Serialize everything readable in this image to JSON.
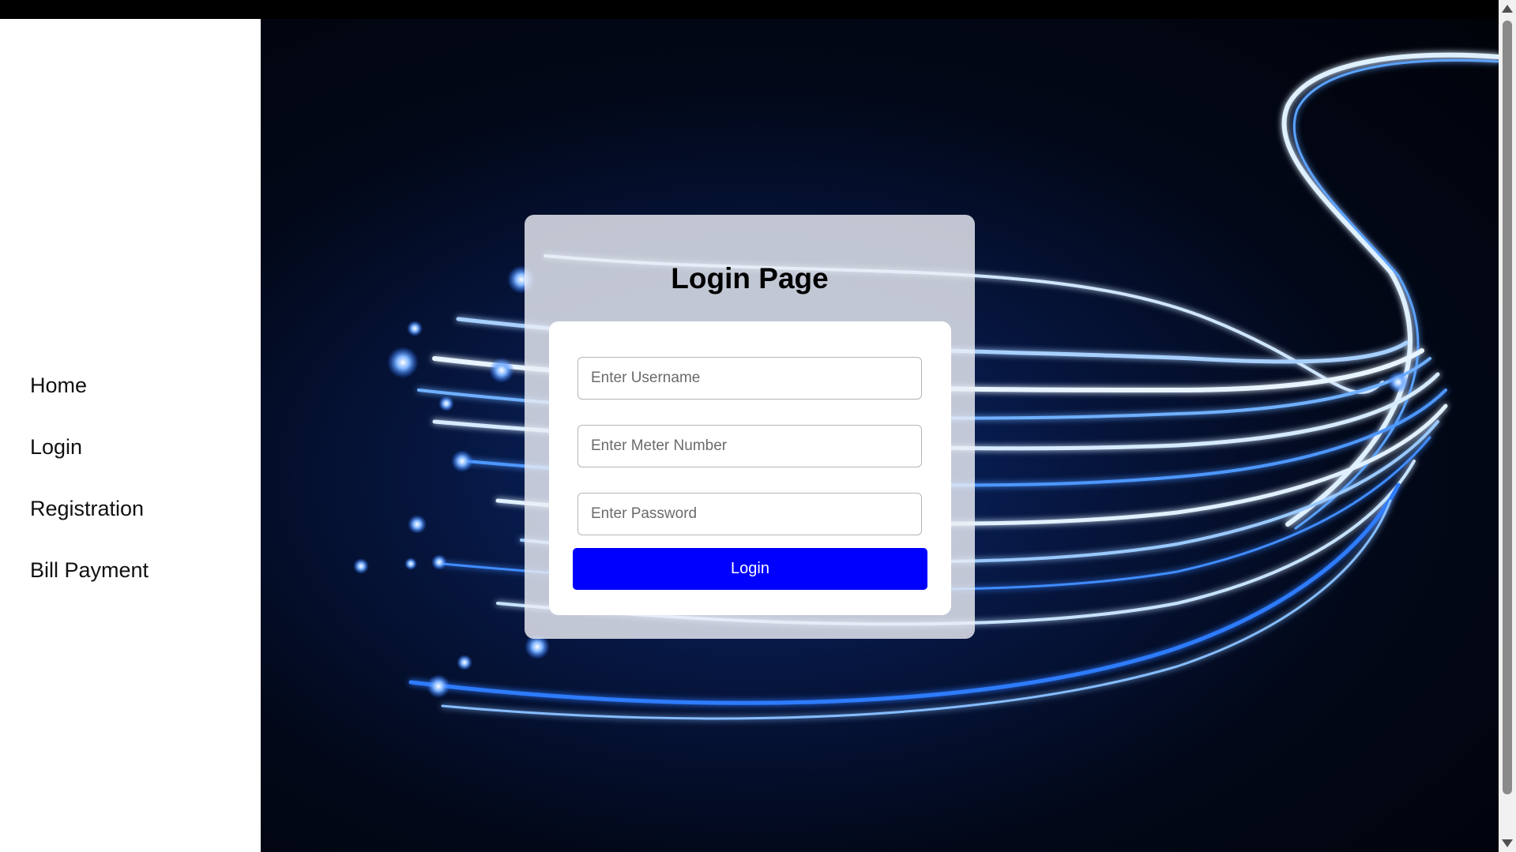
{
  "sidebar": {
    "items": [
      {
        "label": "Home"
      },
      {
        "label": "Login"
      },
      {
        "label": "Registration"
      },
      {
        "label": "Bill Payment"
      }
    ]
  },
  "login_card": {
    "title": "Login Page",
    "fields": {
      "username": {
        "placeholder": "Enter Username",
        "value": ""
      },
      "meter_number": {
        "placeholder": "Enter Meter Number",
        "value": ""
      },
      "password": {
        "placeholder": "Enter Password",
        "value": ""
      }
    },
    "submit_label": "Login"
  },
  "colors": {
    "button": "#0000ff",
    "background_glow": "#1e6bff"
  },
  "icons": [
    "scroll-up-arrow-icon",
    "scroll-down-arrow-icon"
  ]
}
